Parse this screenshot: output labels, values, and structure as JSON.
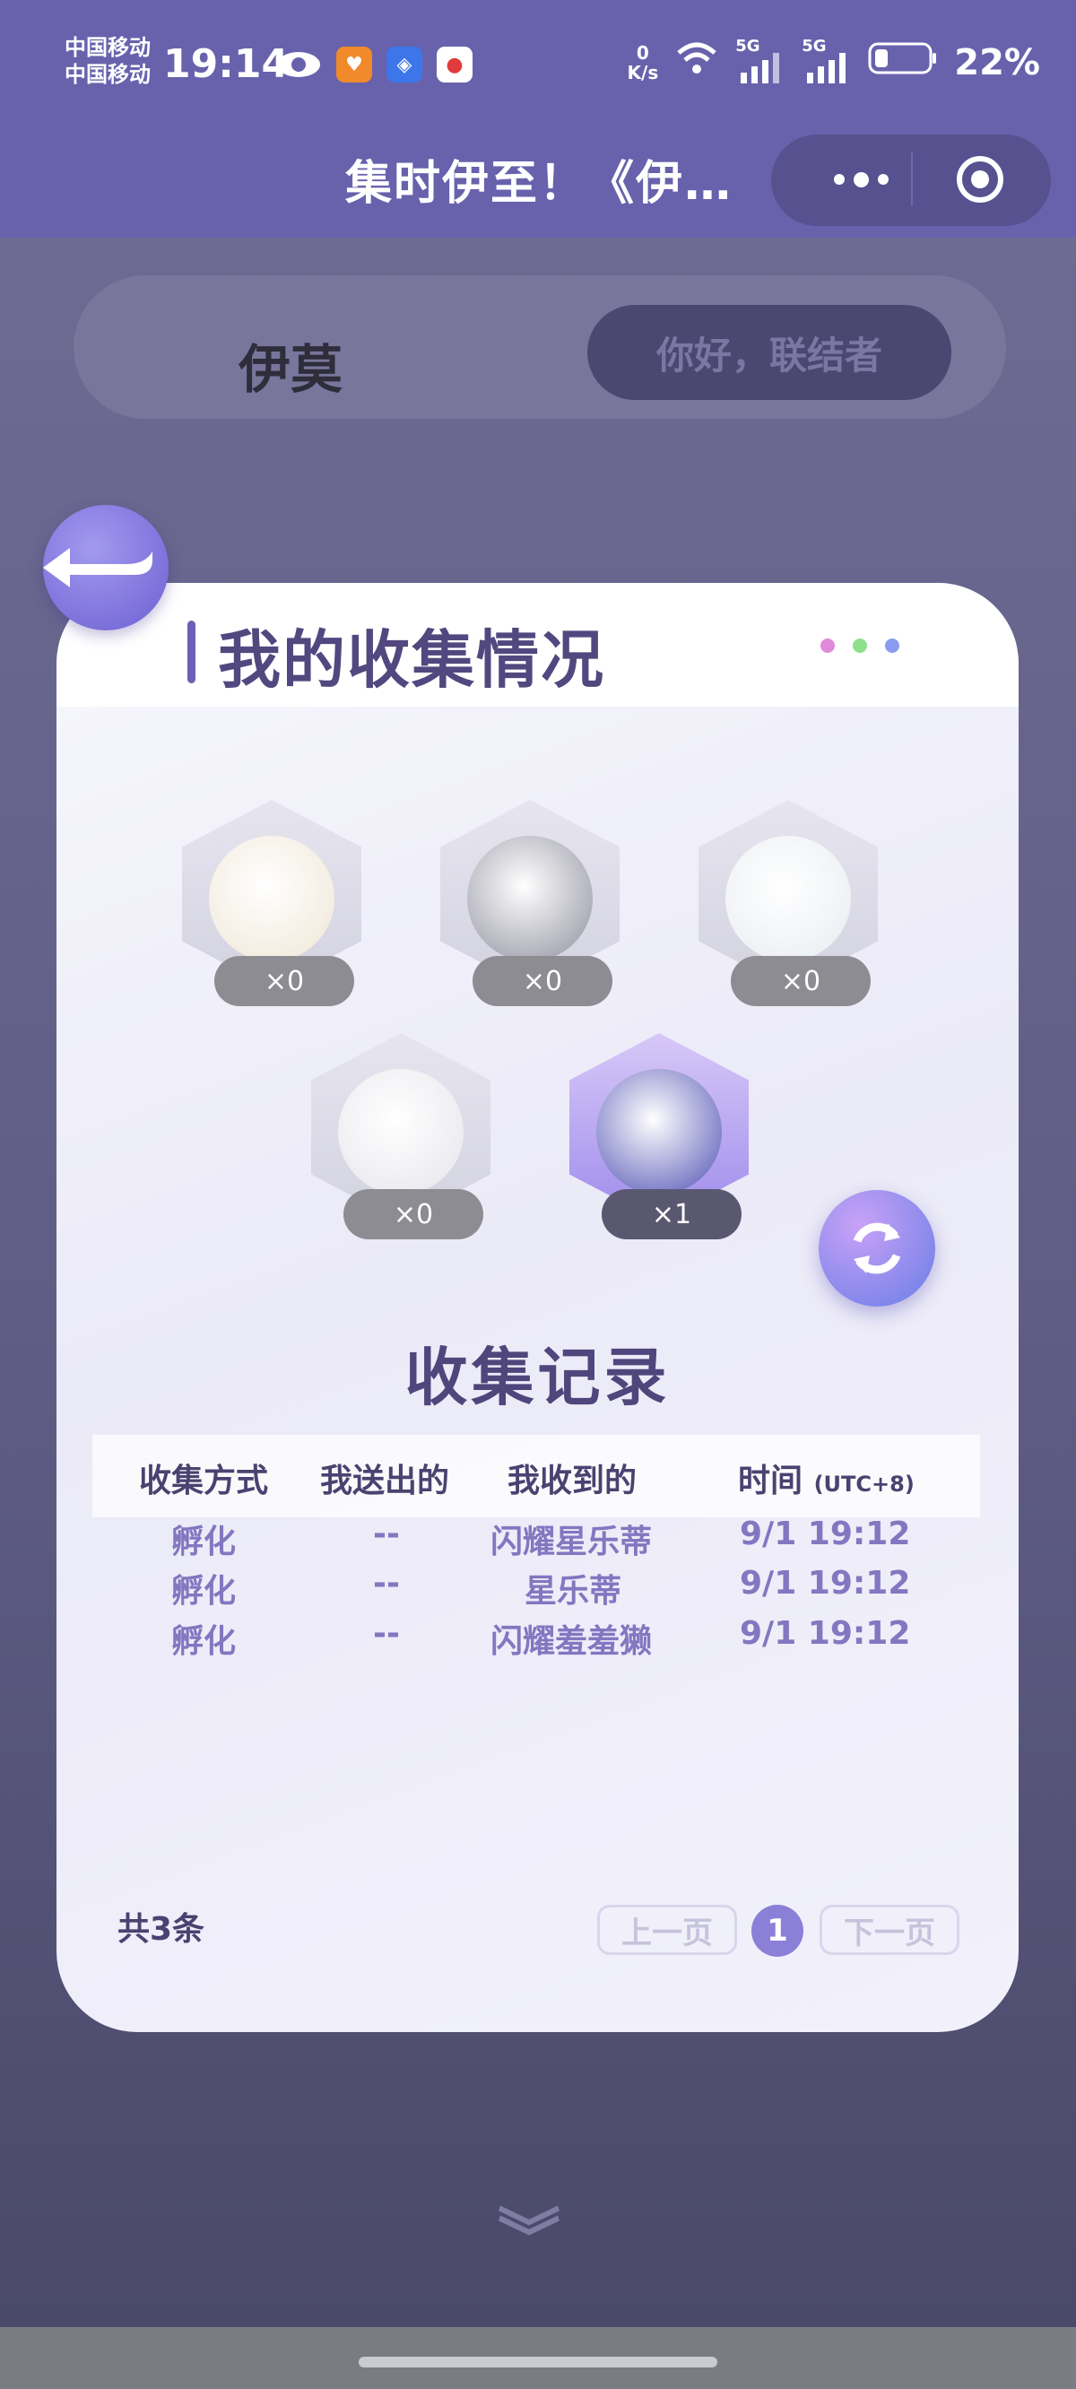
{
  "status_bar": {
    "carrier_1": "中国移动",
    "carrier_2": "中国移动",
    "time": "19:14",
    "net_speed_value": "0",
    "net_speed_unit": "K/s",
    "battery": "22%",
    "signal_1": "5G",
    "signal_2": "5G",
    "icons": [
      "eye-icon",
      "heart-app-icon",
      "blue-app-icon",
      "map-app-icon",
      "wifi-icon",
      "signal-icon",
      "battery-icon"
    ]
  },
  "nav": {
    "title": "集时伊至！《伊…"
  },
  "background": {
    "logo": "伊莫",
    "greeting": "你好，联结者"
  },
  "modal": {
    "title": "我的收集情况",
    "accent_colors": [
      "#e08ad9",
      "#8fe08a",
      "#8a9cf0"
    ],
    "creatures": [
      {
        "name": "cream-creature",
        "count": "×0",
        "color": "#efe6d5"
      },
      {
        "name": "gray-fox-creature",
        "count": "×0",
        "color": "#8d8e9c"
      },
      {
        "name": "cloud-creature",
        "count": "×0",
        "color": "#e8ecf0"
      },
      {
        "name": "otter-creature",
        "count": "×0",
        "color": "#e6e4ea"
      },
      {
        "name": "star-creature",
        "count": "×1",
        "color": "#4d4fb2"
      }
    ],
    "records_title": "收集记录",
    "columns": [
      "收集方式",
      "我送出的",
      "我收到的",
      "时间"
    ],
    "time_suffix": "(UTC+8)",
    "rows": [
      [
        "孵化",
        "--",
        "闪耀星乐蒂",
        "9/1 19:12"
      ],
      [
        "孵化",
        "--",
        "星乐蒂",
        "9/1 19:12"
      ],
      [
        "孵化",
        "--",
        "闪耀羞羞獭",
        "9/1 19:12"
      ]
    ],
    "total": "共3条",
    "prev_page": "上一页",
    "page": "1",
    "next_page": "下一页"
  }
}
